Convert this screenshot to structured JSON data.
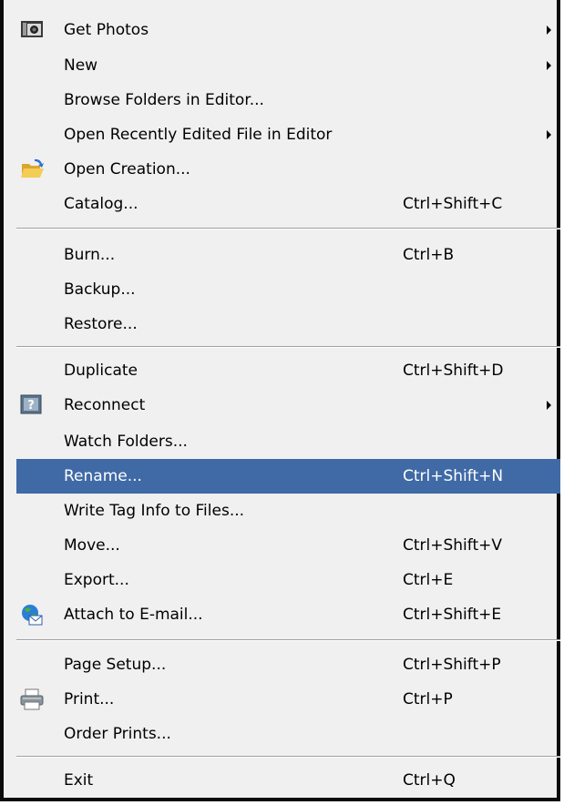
{
  "menu": {
    "get_photos": {
      "label": "Get Photos",
      "icon": "camera-icon"
    },
    "new": {
      "label": "New"
    },
    "browse_folders": {
      "label": "Browse Folders in Editor..."
    },
    "open_recent": {
      "label": "Open Recently Edited File in Editor"
    },
    "open_creation": {
      "label": "Open Creation...",
      "icon": "folder-open-icon"
    },
    "catalog": {
      "label": "Catalog...",
      "shortcut": "Ctrl+Shift+C"
    },
    "burn": {
      "label": "Burn...",
      "shortcut": "Ctrl+B"
    },
    "backup": {
      "label": "Backup..."
    },
    "restore": {
      "label": "Restore..."
    },
    "duplicate": {
      "label": "Duplicate",
      "shortcut": "Ctrl+Shift+D"
    },
    "reconnect": {
      "label": "Reconnect",
      "icon": "question-icon"
    },
    "watch_folders": {
      "label": "Watch Folders..."
    },
    "rename": {
      "label": "Rename...",
      "shortcut": "Ctrl+Shift+N"
    },
    "write_tag": {
      "label": "Write Tag Info to Files..."
    },
    "move": {
      "label": "Move...",
      "shortcut": "Ctrl+Shift+V"
    },
    "export": {
      "label": "Export...",
      "shortcut": "Ctrl+E"
    },
    "attach_email": {
      "label": "Attach to E-mail...",
      "shortcut": "Ctrl+Shift+E",
      "icon": "email-globe-icon"
    },
    "page_setup": {
      "label": "Page Setup...",
      "shortcut": "Ctrl+Shift+P"
    },
    "print": {
      "label": "Print...",
      "shortcut": "Ctrl+P",
      "icon": "printer-icon"
    },
    "order_prints": {
      "label": "Order Prints..."
    },
    "exit": {
      "label": "Exit",
      "shortcut": "Ctrl+Q"
    }
  },
  "colors": {
    "highlight": "#3f6aa6",
    "menu_bg": "#f0f0f0",
    "border": "#0a0a0a"
  }
}
